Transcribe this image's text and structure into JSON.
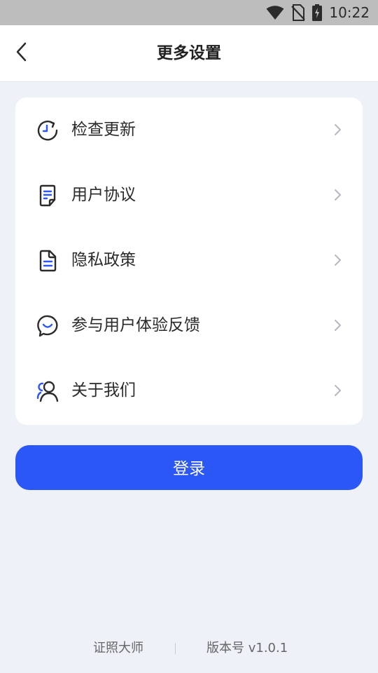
{
  "status_bar": {
    "time": "10:22",
    "icons": [
      "wifi-icon",
      "no-sim-icon",
      "battery-charging-icon"
    ]
  },
  "header": {
    "title": "更多设置",
    "back_icon": "chevron-left-icon"
  },
  "settings": {
    "items": [
      {
        "label": "检查更新",
        "icon": "update-clock-icon"
      },
      {
        "label": "用户协议",
        "icon": "agreement-document-icon"
      },
      {
        "label": "隐私政策",
        "icon": "privacy-document-icon"
      },
      {
        "label": "参与用户体验反馈",
        "icon": "feedback-smile-icon"
      },
      {
        "label": "关于我们",
        "icon": "about-users-icon"
      }
    ],
    "arrow_icon": "chevron-right-icon"
  },
  "login": {
    "label": "登录"
  },
  "footer": {
    "app_name": "证照大师",
    "version": "版本号 v1.0.1"
  },
  "colors": {
    "accent": "#2b57f6",
    "page_bg": "#eef1f8",
    "status_bar_bg": "#bdbdbd",
    "icon_dark": "#2b2b2b"
  }
}
